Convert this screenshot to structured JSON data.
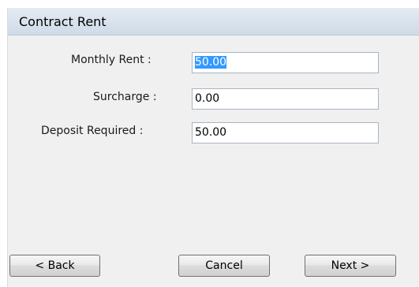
{
  "dialog": {
    "title": "Contract Rent"
  },
  "fields": {
    "monthly_rent": {
      "label": "Monthly Rent :",
      "value": "50.00",
      "selected": true
    },
    "surcharge": {
      "label": "Surcharge :",
      "value": "0.00"
    },
    "deposit_required": {
      "label": "Deposit Required :",
      "value": "50.00"
    }
  },
  "buttons": {
    "back": "< Back",
    "cancel": "Cancel",
    "next": "Next >"
  },
  "colors": {
    "header_bg": "#d4dfeb",
    "dialog_bg": "#f0f0f0",
    "selection": "#3399ff"
  }
}
